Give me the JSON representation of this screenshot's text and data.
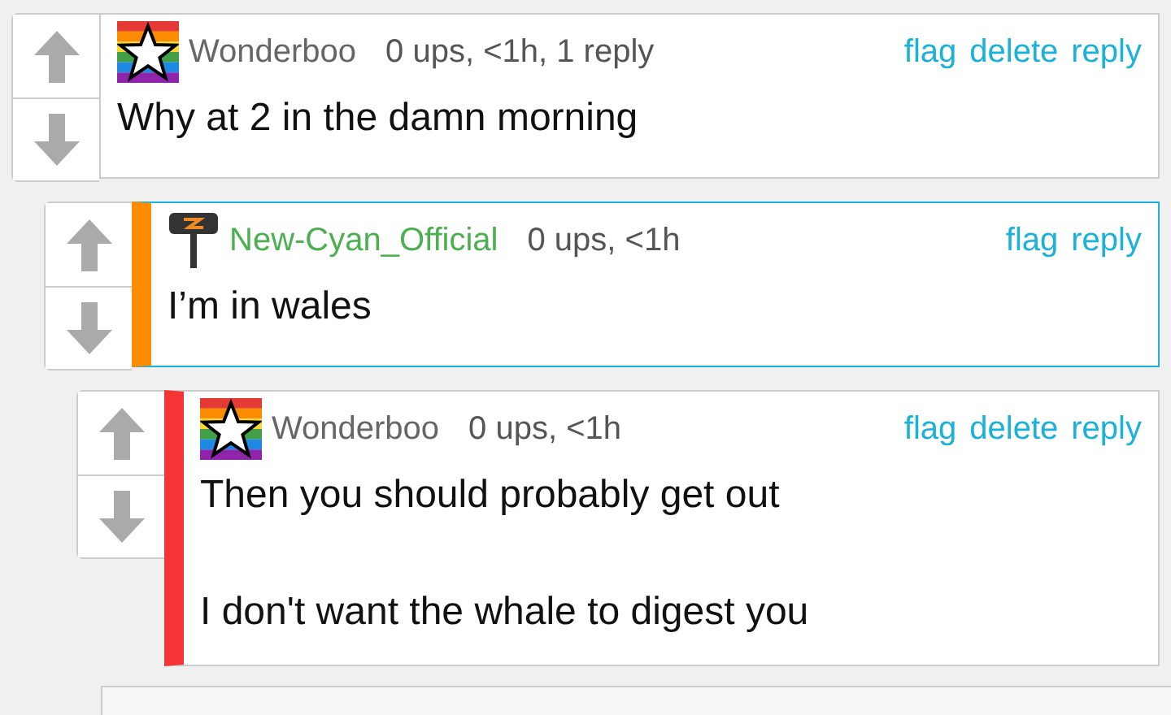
{
  "comments": [
    {
      "kind": "rainbow-star",
      "author": "Wonderboo",
      "author_highlighted": false,
      "meta": "0 ups, <1h, 1 reply",
      "actions": [
        "flag",
        "delete",
        "reply"
      ],
      "outlined": false,
      "paragraphs": [
        "Why at 2 in the damn morning"
      ]
    },
    {
      "kind": "hammer",
      "author": "New-Cyan_Official",
      "author_highlighted": true,
      "meta": "0 ups, <1h",
      "actions": [
        "flag",
        "reply"
      ],
      "color": "#ff8c00",
      "outlined": true,
      "paragraphs": [
        "I’m in wales"
      ]
    },
    {
      "kind": "rainbow-star",
      "author": "Wonderboo",
      "author_highlighted": false,
      "meta": "0 ups, <1h",
      "actions": [
        "flag",
        "delete",
        "reply"
      ],
      "color": "#f53535",
      "outlined": false,
      "paragraphs": [
        "Then you should probably get out",
        "I don't want the whale to digest you"
      ]
    }
  ]
}
